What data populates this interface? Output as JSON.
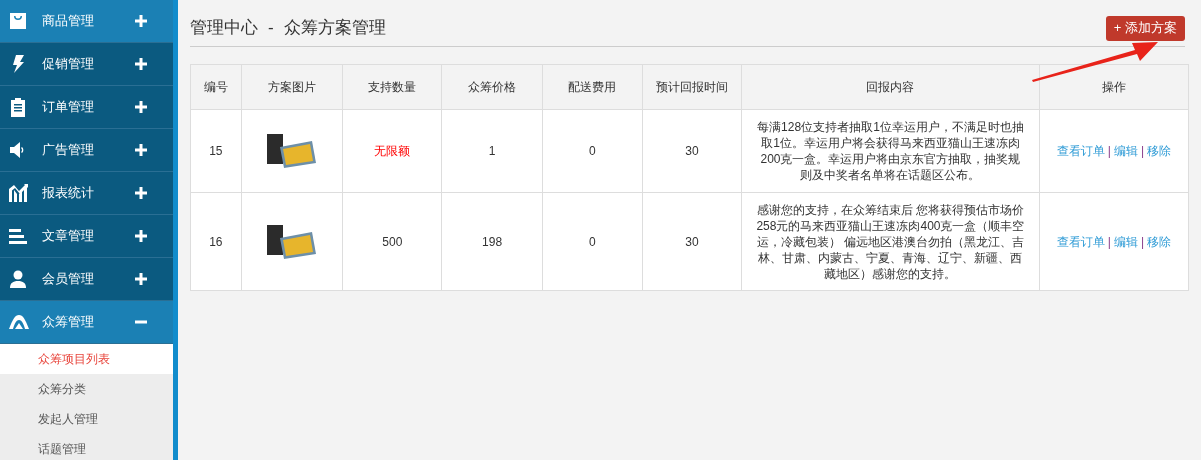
{
  "sidebar": {
    "items": [
      {
        "label": "商品管理",
        "expanded": false,
        "selected": true
      },
      {
        "label": "促销管理",
        "expanded": false,
        "selected": false
      },
      {
        "label": "订单管理",
        "expanded": false,
        "selected": false
      },
      {
        "label": "广告管理",
        "expanded": false,
        "selected": false
      },
      {
        "label": "报表统计",
        "expanded": false,
        "selected": false
      },
      {
        "label": "文章管理",
        "expanded": false,
        "selected": false
      },
      {
        "label": "会员管理",
        "expanded": false,
        "selected": false
      },
      {
        "label": "众筹管理",
        "expanded": true,
        "selected": true,
        "children": [
          {
            "label": "众筹项目列表",
            "selected": true
          },
          {
            "label": "众筹分类",
            "selected": false
          },
          {
            "label": "发起人管理",
            "selected": false
          },
          {
            "label": "话题管理",
            "selected": false
          }
        ]
      }
    ]
  },
  "header": {
    "title": "管理中心",
    "separator": "-",
    "subtitle": "众筹方案管理",
    "add_button": "+ 添加方案"
  },
  "table": {
    "columns": [
      "编号",
      "方案图片",
      "支持数量",
      "众筹价格",
      "配送费用",
      "预计回报时间",
      "回报内容",
      "操作"
    ],
    "rows": [
      {
        "id": "15",
        "support": {
          "text": "无限额",
          "highlighted": true
        },
        "price": "1",
        "shipping": "0",
        "days": "30",
        "reward": "每满128位支持者抽取1位幸运用户，不满足时也抽取1位。幸运用户将会获得马来西亚猫山王速冻肉200克一盒。幸运用户将由京东官方抽取，抽奖规则及中奖者名单将在话题区公布。",
        "actions": [
          "查看订单",
          "编辑",
          "移除"
        ],
        "action_separator": "|"
      },
      {
        "id": "16",
        "support": {
          "text": "500",
          "highlighted": false
        },
        "price": "198",
        "shipping": "0",
        "days": "30",
        "reward": "感谢您的支持，在众筹结束后 您将获得预估市场价258元的马来西亚猫山王速冻肉400克一盒（顺丰空运，冷藏包装） 偏远地区港澳台勿拍（黑龙江、吉林、甘肃、内蒙古、宁夏、青海、辽宁、新疆、西藏地区）感谢您的支持。",
        "actions": [
          "查看订单",
          "编辑",
          "移除"
        ],
        "action_separator": "|"
      }
    ]
  }
}
